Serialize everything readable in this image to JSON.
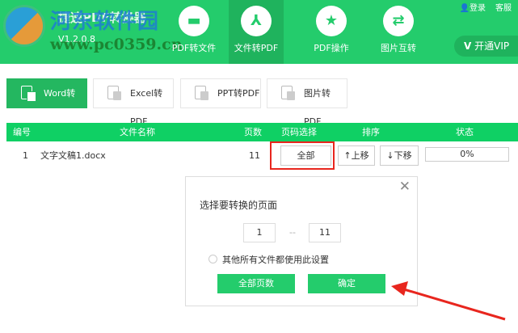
{
  "header": {
    "app_title": "捷速PDF转换器",
    "version": "V1.2.0.8",
    "login": "登录",
    "service": "客服",
    "vip": "开通VIP",
    "nav": [
      {
        "label": "PDF转文件",
        "icon": "folder-icon"
      },
      {
        "label": "文件转PDF",
        "icon": "pdf-icon"
      },
      {
        "label": "PDF操作",
        "icon": "star-icon"
      },
      {
        "label": "图片互转",
        "icon": "swap-icon"
      }
    ]
  },
  "watermark": {
    "name": "河东软件园",
    "url": "www.pc0359.cn"
  },
  "tabs": [
    "Word转PDF",
    "Excel转PDF",
    "PPT转PDF",
    "图片转PDF"
  ],
  "table": {
    "headers": [
      "编号",
      "文件名称",
      "页数",
      "页码选择",
      "排序",
      "状态"
    ],
    "rows": [
      {
        "no": "1",
        "name": "文字文稿1.docx",
        "pages": "11",
        "page_select": "全部",
        "up": "↑上移",
        "down": "↓下移",
        "status": "0%"
      }
    ]
  },
  "dialog": {
    "title": "选择要转换的页面",
    "from": "1",
    "sep": "--",
    "to": "11",
    "apply_all": "其他所有文件都使用此设置",
    "all_pages": "全部页数",
    "confirm": "确定",
    "close": "✕"
  },
  "colors": {
    "brand": "#24cc6c",
    "highlight": "#e8261e"
  }
}
